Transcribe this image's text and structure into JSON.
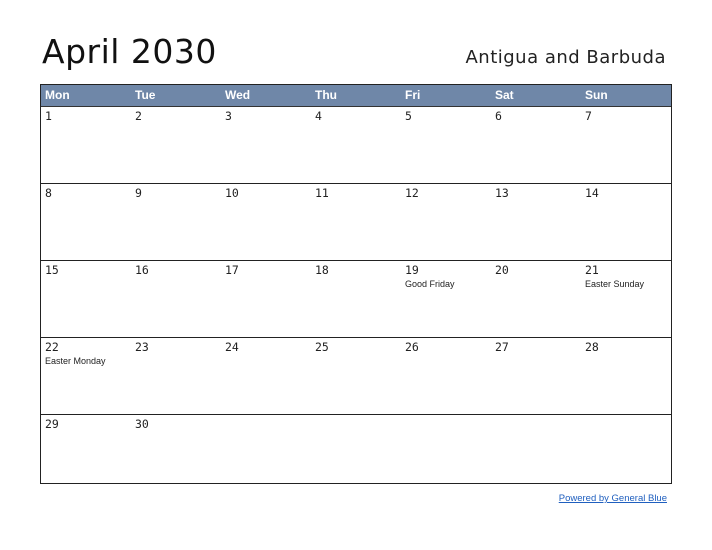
{
  "title": "April 2030",
  "country": "Antigua and Barbuda",
  "weekdays": [
    "Mon",
    "Tue",
    "Wed",
    "Thu",
    "Fri",
    "Sat",
    "Sun"
  ],
  "weeks": [
    [
      {
        "day": "1",
        "holiday": ""
      },
      {
        "day": "2",
        "holiday": ""
      },
      {
        "day": "3",
        "holiday": ""
      },
      {
        "day": "4",
        "holiday": ""
      },
      {
        "day": "5",
        "holiday": ""
      },
      {
        "day": "6",
        "holiday": ""
      },
      {
        "day": "7",
        "holiday": ""
      }
    ],
    [
      {
        "day": "8",
        "holiday": ""
      },
      {
        "day": "9",
        "holiday": ""
      },
      {
        "day": "10",
        "holiday": ""
      },
      {
        "day": "11",
        "holiday": ""
      },
      {
        "day": "12",
        "holiday": ""
      },
      {
        "day": "13",
        "holiday": ""
      },
      {
        "day": "14",
        "holiday": ""
      }
    ],
    [
      {
        "day": "15",
        "holiday": ""
      },
      {
        "day": "16",
        "holiday": ""
      },
      {
        "day": "17",
        "holiday": ""
      },
      {
        "day": "18",
        "holiday": ""
      },
      {
        "day": "19",
        "holiday": "Good Friday"
      },
      {
        "day": "20",
        "holiday": ""
      },
      {
        "day": "21",
        "holiday": "Easter Sunday"
      }
    ],
    [
      {
        "day": "22",
        "holiday": "Easter Monday"
      },
      {
        "day": "23",
        "holiday": ""
      },
      {
        "day": "24",
        "holiday": ""
      },
      {
        "day": "25",
        "holiday": ""
      },
      {
        "day": "26",
        "holiday": ""
      },
      {
        "day": "27",
        "holiday": ""
      },
      {
        "day": "28",
        "holiday": ""
      }
    ],
    [
      {
        "day": "29",
        "holiday": ""
      },
      {
        "day": "30",
        "holiday": ""
      },
      {
        "day": "",
        "holiday": ""
      },
      {
        "day": "",
        "holiday": ""
      },
      {
        "day": "",
        "holiday": ""
      },
      {
        "day": "",
        "holiday": ""
      },
      {
        "day": "",
        "holiday": ""
      }
    ]
  ],
  "footer": {
    "link_text": "Powered by General Blue"
  },
  "colors": {
    "header_bg": "#6f87a8",
    "link": "#1f5fbf"
  }
}
